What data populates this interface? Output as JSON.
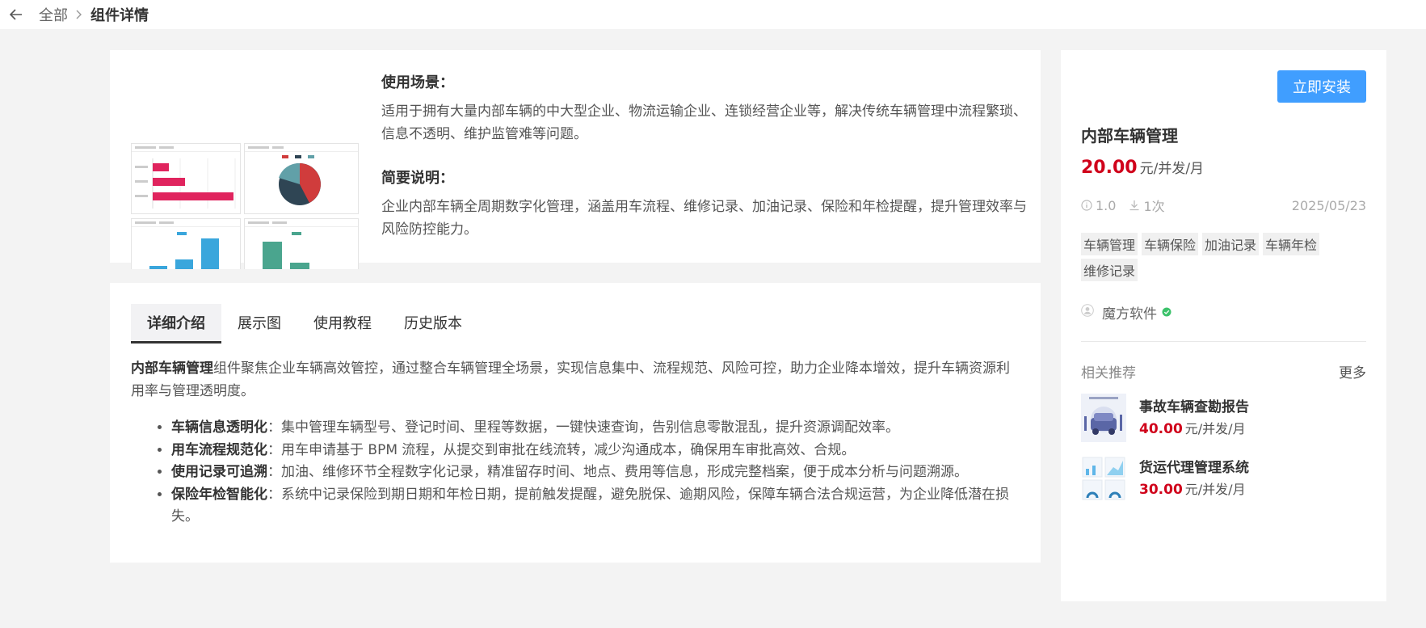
{
  "breadcrumb": {
    "root": "全部",
    "current": "组件详情"
  },
  "overview": {
    "scenario_title": "使用场景：",
    "scenario_text": "适用于拥有大量内部车辆的中大型企业、物流运输企业、连锁经营企业等，解决传统车辆管理中流程繁琐、信息不透明、维护监管难等问题。",
    "summary_title": "简要说明：",
    "summary_text": "企业内部车辆全周期数字化管理，涵盖用车流程、维修记录、加油记录、保险和年检提醒，提升管理效率与风险防控能力。"
  },
  "tabs": [
    {
      "label": "详细介绍",
      "active": true
    },
    {
      "label": "展示图",
      "active": false
    },
    {
      "label": "使用教程",
      "active": false
    },
    {
      "label": "历史版本",
      "active": false
    }
  ],
  "detail": {
    "intro_bold": "内部车辆管理",
    "intro_text": "组件聚焦企业车辆高效管控，通过整合车辆管理全场景，实现信息集中、流程规范、风险可控，助力企业降本增效，提升车辆资源利用率与管理透明度。",
    "features": [
      {
        "title": "车辆信息透明化",
        "text": "：集中管理车辆型号、登记时间、里程等数据，一键快速查询，告别信息零散混乱，提升资源调配效率。"
      },
      {
        "title": "用车流程规范化",
        "text": "：用车申请基于 BPM 流程，从提交到审批在线流转，减少沟通成本，确保用车审批高效、合规。"
      },
      {
        "title": "使用记录可追溯",
        "text": "：加油、维修环节全程数字化记录，精准留存时间、地点、费用等信息，形成完整档案，便于成本分析与问题溯源。"
      },
      {
        "title": "保险年检智能化",
        "text": "：系统中记录保险到期日期和年检日期，提前触发提醒，避免脱保、逾期风险，保障车辆合法合规运营，为企业降低潜在损失。"
      }
    ]
  },
  "product": {
    "install_label": "立即安装",
    "name": "内部车辆管理",
    "price": "20.00",
    "unit": "元/并发/月",
    "version": "1.0",
    "downloads": "1次",
    "date": "2025/05/23",
    "tags": [
      "车辆管理",
      "车辆保险",
      "加油记录",
      "车辆年检",
      "维修记录"
    ],
    "vendor": "魔方软件"
  },
  "related": {
    "title": "相关推荐",
    "more": "更多",
    "items": [
      {
        "name": "事故车辆查勘报告",
        "price": "40.00",
        "unit": "元/并发/月"
      },
      {
        "name": "货运代理管理系统",
        "price": "30.00",
        "unit": "元/并发/月"
      }
    ]
  },
  "colors": {
    "accent": "#409eff",
    "price": "#d0021b",
    "verified": "#3cc26b"
  }
}
